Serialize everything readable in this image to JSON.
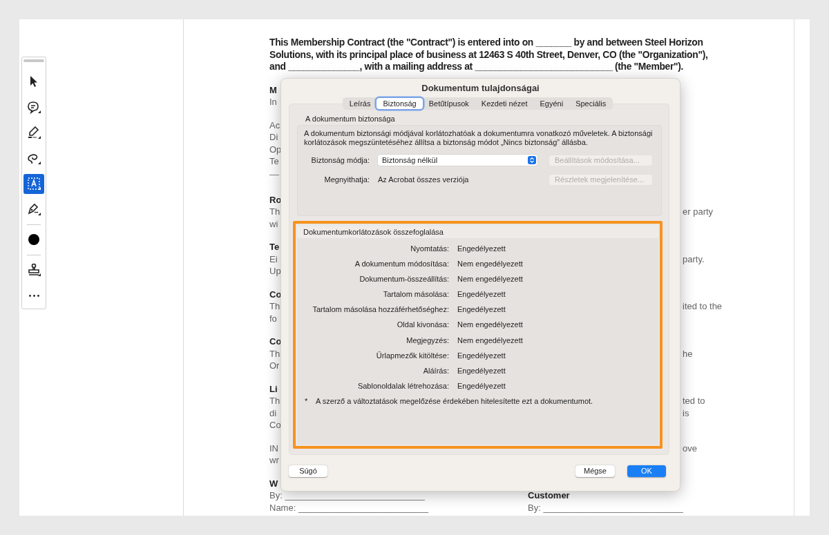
{
  "toolbar": {
    "tools": [
      {
        "kind": "pointer",
        "selected": false
      },
      {
        "kind": "comment",
        "selected": false
      },
      {
        "kind": "highlight",
        "selected": false
      },
      {
        "kind": "lasso",
        "selected": false
      },
      {
        "kind": "text-select",
        "selected": true
      },
      {
        "kind": "sign",
        "selected": false
      },
      {
        "kind": "color",
        "selected": false,
        "color": "#000000"
      },
      {
        "kind": "stamp",
        "selected": false
      },
      {
        "kind": "more",
        "selected": false
      }
    ]
  },
  "document": {
    "intro": "This Membership Contract (the \"Contract\") is entered into on _______ by and between Steel Horizon Solutions, with its principal place of business at 12463 S 40th Street, Denver, CO (the \"Organization\"), and ______________, with a mailing address at ___________________________ (the \"Member\").",
    "sections": [
      {
        "heading": "M",
        "lines": [
          {
            "left": "In"
          }
        ]
      },
      {
        "lines": [
          {
            "left": "Ac"
          },
          {
            "left": "Di"
          },
          {
            "left": "Op"
          },
          {
            "left": "Te"
          }
        ]
      },
      {
        "kind": "rule"
      },
      {
        "heading": "Ro",
        "lines": [
          {
            "left": "Th",
            "right": "er party"
          },
          {
            "left": "wi"
          }
        ]
      },
      {
        "heading": "Te",
        "lines": [
          {
            "left": "Ei",
            "right": "party."
          },
          {
            "left": "Up"
          }
        ]
      },
      {
        "heading": "Co",
        "lines": [
          {
            "left": "Th",
            "right": "ited to the"
          },
          {
            "left": "fo"
          }
        ]
      },
      {
        "heading": "Co",
        "lines": [
          {
            "left": "Th",
            "right": "he"
          },
          {
            "left": "Or"
          }
        ]
      },
      {
        "heading": "Li",
        "lines": [
          {
            "left": "Th",
            "right": "ted to"
          },
          {
            "left": "di",
            "right": "is"
          },
          {
            "left": "Co"
          }
        ]
      },
      {
        "lines": [
          {
            "left": "IN",
            "right": "ove"
          },
          {
            "left": "wr"
          }
        ]
      }
    ],
    "signature": [
      {
        "heading": "W",
        "lines": [
          "By: ____________________________",
          "Name: __________________________"
        ]
      },
      {
        "heading": "Customer",
        "lines": [
          "By: ____________________________"
        ]
      }
    ]
  },
  "dialog": {
    "title": "Dokumentum tulajdonságai",
    "tabs": [
      {
        "label": "Leírás",
        "selected": false
      },
      {
        "label": "Biztonság",
        "selected": true
      },
      {
        "label": "Betűtípusok",
        "selected": false
      },
      {
        "label": "Kezdeti nézet",
        "selected": false
      },
      {
        "label": "Egyéni",
        "selected": false
      },
      {
        "label": "Speciális",
        "selected": false
      }
    ],
    "security": {
      "title": "A dokumentum biztonsága",
      "description": "A dokumentum biztonsági módjával korlátozhatóak a dokumentumra vonatkozó műveletek. A biztonsági korlátozások megszüntetéséhez állítsa a biztonság módot „Nincs biztonság” állásba.",
      "rows": [
        {
          "label": "Biztonság módja:",
          "kind": "select",
          "value": "Biztonság nélkül",
          "button": {
            "label": "Beállítások módosítása...",
            "disabled": true
          }
        },
        {
          "label": "Megnyithatja:",
          "kind": "text",
          "value": "Az Acrobat összes verziója",
          "button": {
            "label": "Részletek megjelenítése...",
            "disabled": true
          }
        }
      ]
    },
    "restrictions": {
      "title": "Dokumentumkorlátozások összefoglalása",
      "highlighted": true,
      "rows": [
        {
          "label": "Nyomtatás:",
          "value": "Engedélyezett"
        },
        {
          "label": "A dokumentum módosítása:",
          "value": "Nem engedélyezett"
        },
        {
          "label": "Dokumentum-összeállítás:",
          "value": "Nem engedélyezett"
        },
        {
          "label": "Tartalom másolása:",
          "value": "Engedélyezett"
        },
        {
          "label": "Tartalom másolása hozzáférhetőséghez:",
          "value": "Engedélyezett"
        },
        {
          "label": "Oldal kivonása:",
          "value": "Nem engedélyezett"
        },
        {
          "label": "Megjegyzés:",
          "value": "Nem engedélyezett"
        },
        {
          "label": "Űrlapmezők kitöltése:",
          "value": "Engedélyezett"
        },
        {
          "label": "Aláírás:",
          "value": "Engedélyezett"
        },
        {
          "label": "Sablonoldalak létrehozása:",
          "value": "Engedélyezett"
        }
      ],
      "footnote_mark": "*",
      "footnote": "A szerző a változtatások megelőzése érdekében hitelesítette ezt a dokumentumot."
    },
    "buttons": [
      {
        "label": "Súgó",
        "kind": "help",
        "primary": false
      },
      {
        "label": "Mégse",
        "kind": "cancel",
        "primary": false
      },
      {
        "label": "OK",
        "kind": "ok",
        "primary": true
      }
    ]
  }
}
